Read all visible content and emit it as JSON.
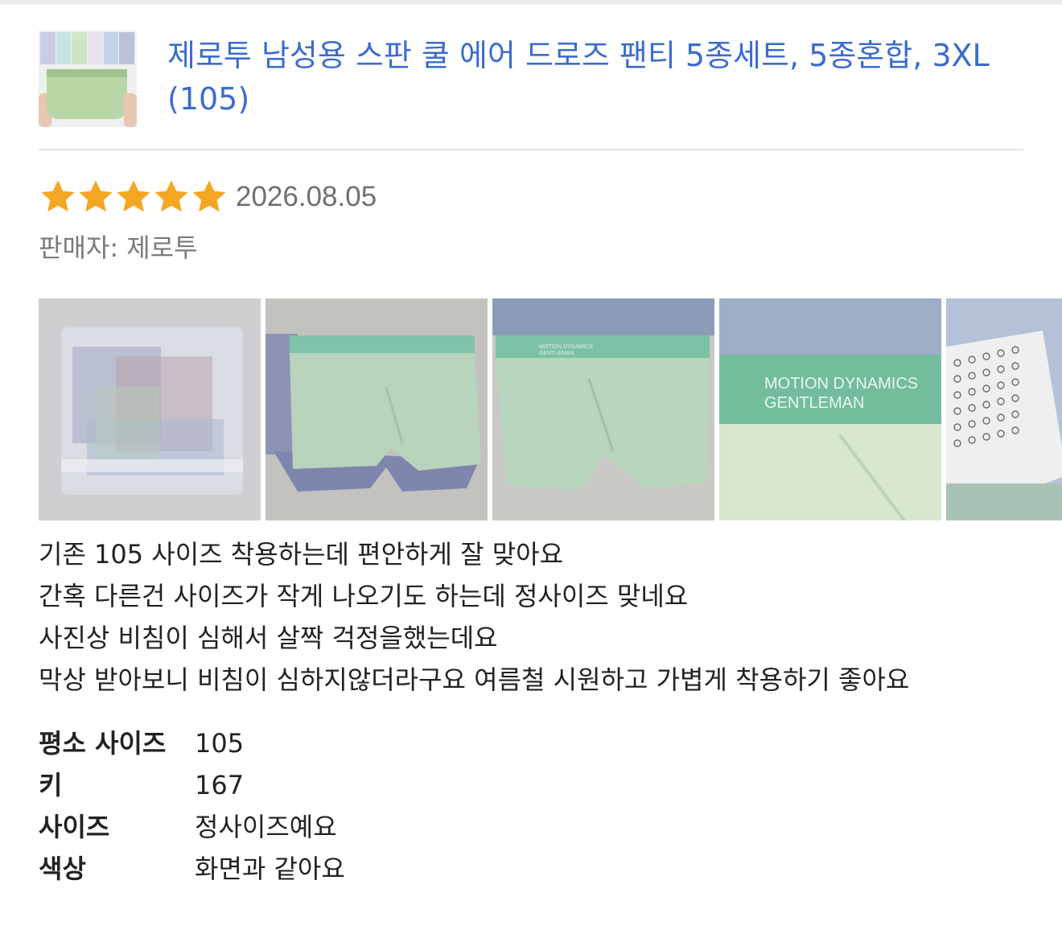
{
  "product": {
    "title": "제로투 남성용 스판 쿨 에어 드로즈 팬티 5종세트, 5종혼합, 3XL (105)",
    "thumb_colors": [
      "#c9cde6",
      "#c9e3e4",
      "#cfe6c6",
      "#e8e2ee",
      "#c2d3ea",
      "#b9c2d6"
    ]
  },
  "review": {
    "rating": 5,
    "rating_max": 5,
    "star_color": "#f5a623",
    "date": "2026.08.05",
    "seller": "판매자: 제로투",
    "photos": [
      {
        "name": "packaged-bag"
      },
      {
        "name": "green-briefs-flat"
      },
      {
        "name": "green-briefs-front",
        "waistband_text": "MOTION DYNAMICS\nGENTLEMAN"
      },
      {
        "name": "waistband-closeup",
        "waistband_text": "MOTION DYNAMICS\nGENTLEMAN"
      },
      {
        "name": "pattern-fabric"
      }
    ],
    "lines": [
      "기존 105 사이즈 착용하는데 편안하게 잘 맞아요",
      "간혹 다른건 사이즈가 작게 나오기도 하는데 정사이즈 맞네요",
      "사진상 비침이 심해서 살짝 걱정을했는데요",
      "막상 받아보니 비침이 심하지않더라구요 여름철 시원하고 가볍게 착용하기 좋아요"
    ],
    "attributes": [
      {
        "key": "평소 사이즈",
        "value": "105"
      },
      {
        "key": "키",
        "value": "167"
      },
      {
        "key": "사이즈",
        "value": "정사이즈예요"
      },
      {
        "key": "색상",
        "value": "화면과 같아요"
      }
    ]
  }
}
